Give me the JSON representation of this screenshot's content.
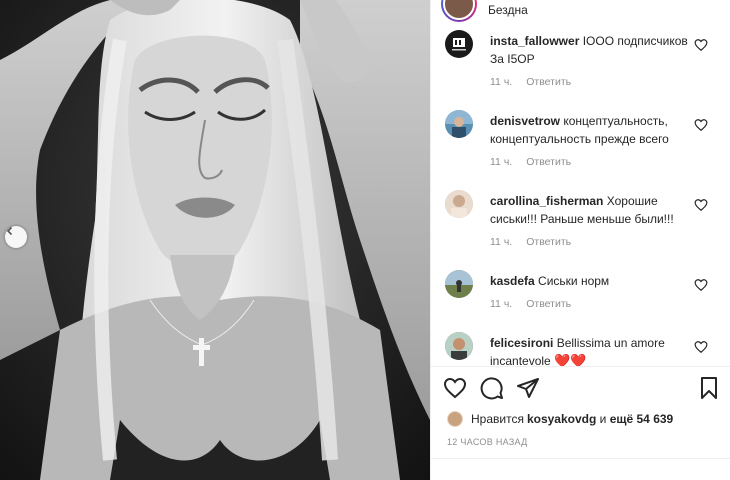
{
  "post": {
    "location": "Бездна",
    "likes_prefix": "Нравится ",
    "likes_user": "kosyakovdg",
    "likes_and": " и ",
    "likes_rest": "ещё 54 639",
    "time": "12 ЧАСОВ НАЗАД"
  },
  "comments": [
    {
      "user": "insta_fallowwer",
      "text": "IOOO подписчиков За I5OP",
      "age": "11 ч.",
      "reply": "Ответить",
      "avatar_color": "#1a1a1a"
    },
    {
      "user": "denisvetrow",
      "text": "концептуальность, концептуальность прежде всего",
      "age": "11 ч.",
      "reply": "Ответить",
      "avatar_color": "#5a8fb4"
    },
    {
      "user": "carollina_fisherman",
      "text": "Хорошие сиськи!!! Раньше меньше были!!!",
      "age": "11 ч.",
      "reply": "Ответить",
      "avatar_color": "#d8c2b0"
    },
    {
      "user": "kasdefa",
      "text": "Сиськи норм",
      "age": "11 ч.",
      "reply": "Ответить",
      "avatar_color": "#7a8f5c"
    },
    {
      "user": "felicesironi",
      "text": "Bellissima un amore incantevole",
      "hearts": "❤️❤️",
      "age": "",
      "reply": "",
      "avatar_color": "#8a6a55"
    }
  ],
  "icons": [
    "heart-icon",
    "comment-icon",
    "share-icon",
    "bookmark-icon",
    "chevron-left-icon"
  ]
}
